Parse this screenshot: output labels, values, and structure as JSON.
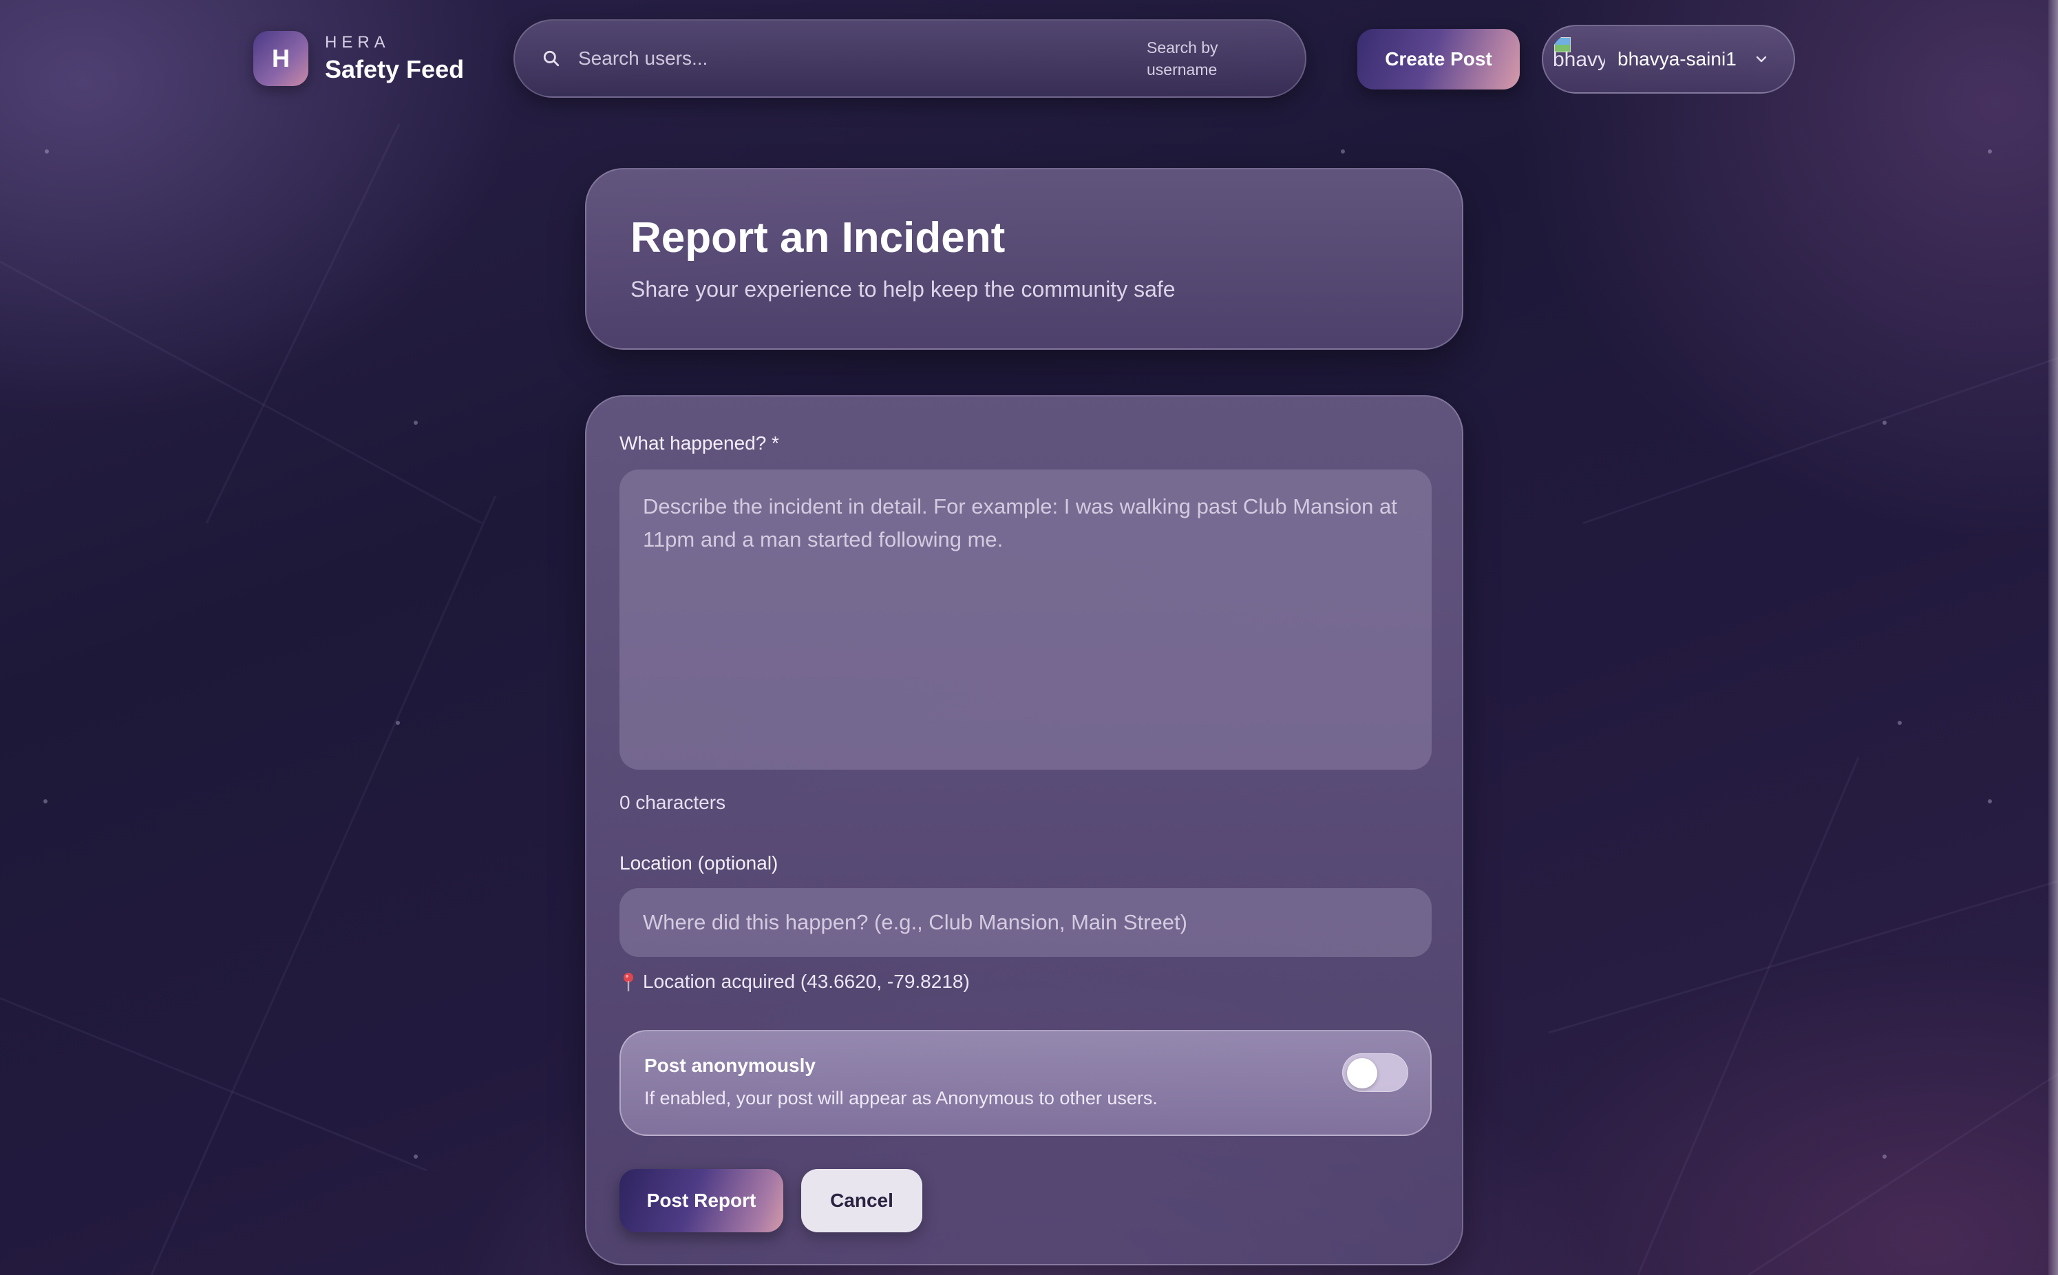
{
  "brand": {
    "logo_letter": "H",
    "kicker": "HERA",
    "name": "Safety Feed"
  },
  "search": {
    "placeholder": "Search users...",
    "hint": "Search by username",
    "icon": "search-icon"
  },
  "header": {
    "create_post_label": "Create Post",
    "user": {
      "avatar_alt": "bhavya",
      "username": "bhavya-saini1",
      "icon": "chevron-down-icon"
    }
  },
  "page": {
    "title": "Report an Incident",
    "subtitle": "Share your experience to help keep the community safe"
  },
  "form": {
    "description_label": "What happened? *",
    "description_placeholder": "Describe the incident in detail. For example: I was walking past Club Mansion at 11pm and a man started following me.",
    "description_value": "",
    "char_count": "0 characters",
    "location_label": "Location (optional)",
    "location_placeholder": "Where did this happen? (e.g., Club Mansion, Main Street)",
    "location_value": "",
    "location_status": "Location acquired (43.6620, -79.8218)",
    "location_icon": "pin-icon",
    "anonymous": {
      "title": "Post anonymously",
      "description": "If enabled, your post will appear as Anonymous to other users.",
      "enabled": false
    },
    "submit_label": "Post Report",
    "cancel_label": "Cancel"
  },
  "colors": {
    "accent_start": "#3a2d70",
    "accent_end": "#d69aa8",
    "background": "#1d1838"
  }
}
